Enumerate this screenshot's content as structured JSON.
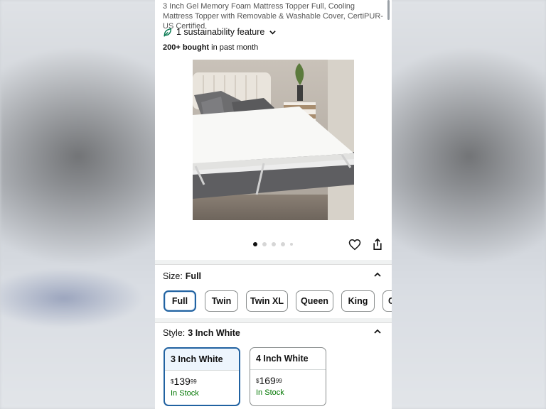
{
  "product": {
    "title": "3 Inch Gel Memory Foam Mattress Topper Full, Cooling Mattress Topper with Removable & Washable Cover, CertiPUR-US Certified",
    "sustainability": "1 sustainability feature",
    "bought_count": "200+ bought",
    "bought_suffix": " in past month",
    "image_alt": "Mattress topper on bed"
  },
  "carousel": {
    "total_dots": 5,
    "active_index": 0
  },
  "size": {
    "label": "Size:",
    "selected": "Full",
    "options": [
      "Full",
      "Twin",
      "Twin XL",
      "Queen",
      "King",
      "C"
    ]
  },
  "style": {
    "label": "Style:",
    "selected": "3 Inch White",
    "options": [
      {
        "name": "3 Inch White",
        "currency": "$",
        "dollars": "139",
        "cents": "99",
        "stock": "In Stock"
      },
      {
        "name": "4 Inch White",
        "currency": "$",
        "dollars": "169",
        "cents": "99",
        "stock": "In Stock"
      }
    ]
  },
  "colors": {
    "accent": "#2162a1",
    "in_stock": "#007600",
    "leaf": "#0a7a53"
  },
  "icons": [
    "leaf-icon",
    "chevron-down-icon",
    "heart-icon",
    "share-icon",
    "chevron-up-icon"
  ]
}
